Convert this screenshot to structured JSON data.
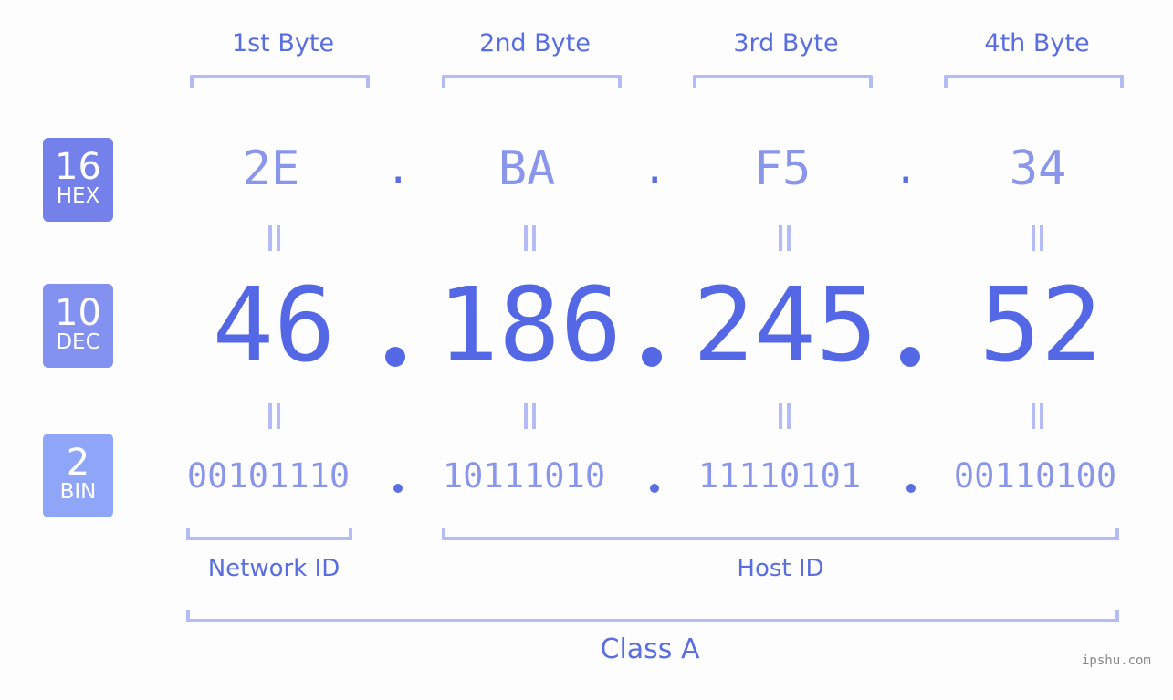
{
  "bytes": [
    {
      "label": "1st Byte",
      "hex": "2E",
      "dec": "46",
      "bin": "00101110"
    },
    {
      "label": "2nd Byte",
      "hex": "BA",
      "dec": "186",
      "bin": "10111010"
    },
    {
      "label": "3rd Byte",
      "hex": "F5",
      "dec": "245",
      "bin": "11110101"
    },
    {
      "label": "4th Byte",
      "hex": "34",
      "dec": "52",
      "bin": "00110100"
    }
  ],
  "separator": ".",
  "badges": {
    "hex": {
      "num": "16",
      "label": "HEX",
      "color": "#7481ea"
    },
    "dec": {
      "num": "10",
      "label": "DEC",
      "color": "#8391f0"
    },
    "bin": {
      "num": "2",
      "label": "BIN",
      "color": "#8fa6f8"
    }
  },
  "groups": {
    "network": "Network ID",
    "host": "Host ID",
    "class": "Class A"
  },
  "watermark": "ipshu.com",
  "colors": {
    "accent": "#5468e6",
    "light": "#b3bcf5",
    "mid": "#8a96ea"
  }
}
